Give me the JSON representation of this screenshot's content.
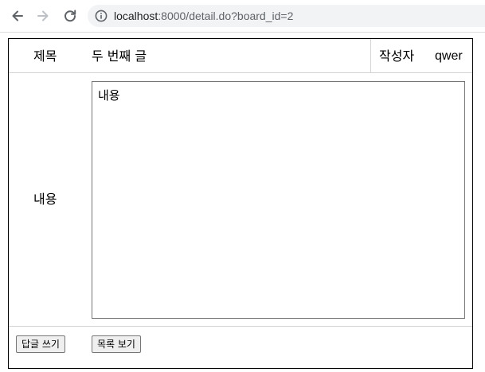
{
  "browser": {
    "url_host": "localhost",
    "url_rest": ":8000/detail.do?board_id=2"
  },
  "post": {
    "title_label": "제목",
    "title_value": "두 번째 글",
    "author_label": "작성자",
    "author_value": "qwer",
    "content_label": "내용",
    "content_value": "내용"
  },
  "actions": {
    "reply_label": "답글 쓰기",
    "list_label": "목록 보기"
  }
}
